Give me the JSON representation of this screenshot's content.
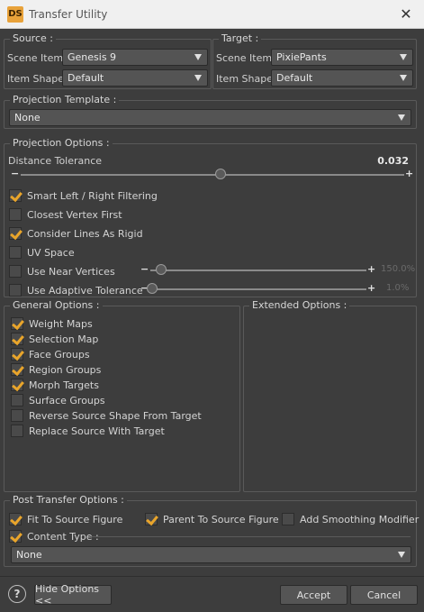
{
  "window": {
    "icon_text": "DS",
    "title": "Transfer Utility",
    "close_glyph": "✕"
  },
  "source": {
    "title": "Source :",
    "scene_item_label": "Scene Item :",
    "scene_item_value": "Genesis 9",
    "item_shape_label": "Item Shape :",
    "item_shape_value": "Default"
  },
  "target": {
    "title": "Target :",
    "scene_item_label": "Scene Item :",
    "scene_item_value": "PixiePants",
    "item_shape_label": "Item Shape :",
    "item_shape_value": "Default"
  },
  "projection_template": {
    "title": "Projection Template :",
    "value": "None"
  },
  "projection_options": {
    "title": "Projection Options :",
    "distance_tolerance_label": "Distance Tolerance",
    "distance_tolerance_value": "0.032",
    "distance_tolerance_fraction": 0.52,
    "minus": "−",
    "plus": "+",
    "checks": [
      {
        "label": "Smart Left / Right Filtering",
        "checked": true
      },
      {
        "label": "Closest Vertex First",
        "checked": false
      },
      {
        "label": "Consider Lines As Rigid",
        "checked": true
      },
      {
        "label": "UV Space",
        "checked": false
      },
      {
        "label": "Use Near Vertices",
        "checked": false
      },
      {
        "label": "Use Adaptive Tolerance",
        "checked": false
      }
    ],
    "near_vertices_value": "150.0%",
    "near_vertices_fraction": 0.05,
    "adaptive_tolerance_value": "1.0%",
    "adaptive_tolerance_fraction": 0.01
  },
  "general_options": {
    "title": "General Options :",
    "checks": [
      {
        "label": "Weight Maps",
        "checked": true
      },
      {
        "label": "Selection Map",
        "checked": true
      },
      {
        "label": "Face Groups",
        "checked": true
      },
      {
        "label": "Region Groups",
        "checked": true
      },
      {
        "label": "Morph Targets",
        "checked": true
      },
      {
        "label": "Surface Groups",
        "checked": false
      },
      {
        "label": "Reverse Source Shape From Target",
        "checked": false
      },
      {
        "label": "Replace Source With Target",
        "checked": false
      }
    ]
  },
  "extended_options": {
    "title": "Extended Options :"
  },
  "post_transfer": {
    "title": "Post Transfer Options :",
    "fit_to_source": {
      "label": "Fit To Source Figure",
      "checked": true
    },
    "parent_to_source": {
      "label": "Parent To Source Figure",
      "checked": true
    },
    "add_smoothing": {
      "label": "Add Smoothing Modifier",
      "checked": false
    },
    "content_type": {
      "label": "Content Type :",
      "checked": true,
      "value": "None"
    }
  },
  "footer": {
    "help_glyph": "?",
    "hide_options_label": "Hide Options <<",
    "accept_label": "Accept",
    "cancel_label": "Cancel"
  },
  "colors": {
    "check_accent": "#e9a52b",
    "background": "#3d3d3d"
  }
}
